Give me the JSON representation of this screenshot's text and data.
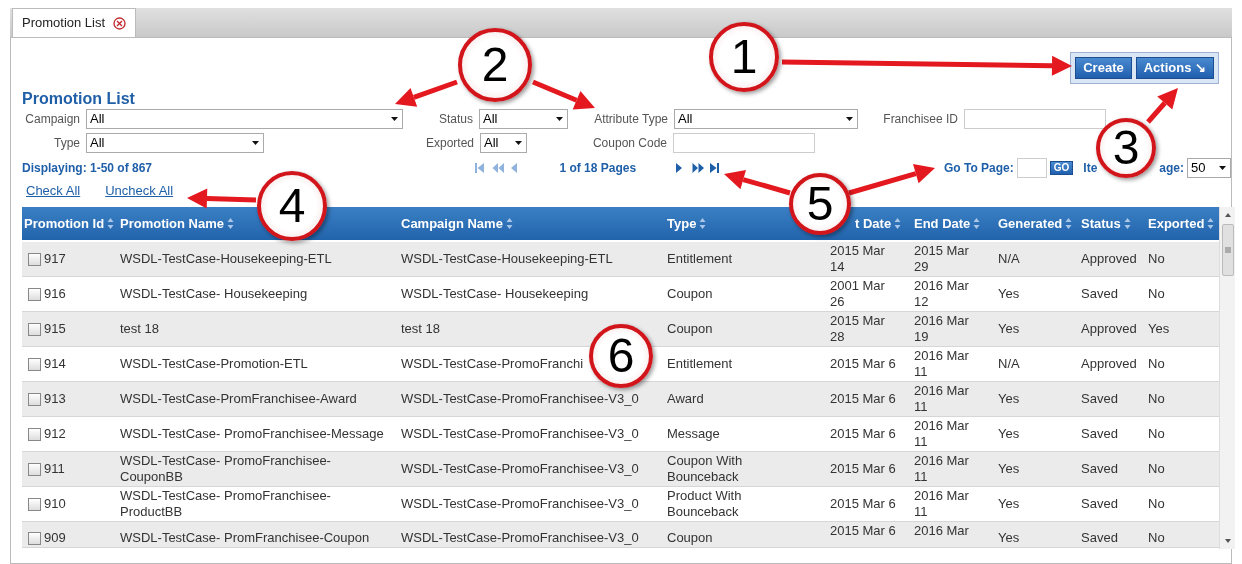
{
  "tab": {
    "label": "Promotion List",
    "selected": true
  },
  "page_title": "Promotion List",
  "buttons": [
    "Create",
    "Actions ↘"
  ],
  "filters": [
    {
      "label": "Campaign",
      "kind": "select",
      "value": "All"
    },
    {
      "label": "Status",
      "kind": "select",
      "value": "All"
    },
    {
      "label": "Attribute Type",
      "kind": "select",
      "value": "All"
    },
    {
      "label": "Franchisee ID",
      "kind": "input"
    },
    {
      "label": "Type",
      "kind": "select",
      "value": "All"
    },
    {
      "label": "Exported",
      "kind": "select",
      "value": "All"
    },
    {
      "label": "Coupon Code",
      "kind": "input"
    }
  ],
  "pager": {
    "displaying": "Displaying: 1-50 of 867",
    "page_info": "1 of 18 Pages",
    "nav": [
      {
        "kind": "first",
        "disabled": true
      },
      {
        "kind": "fast-back",
        "disabled": true
      },
      {
        "kind": "back",
        "disabled": true
      },
      {
        "kind": "next",
        "disabled": false
      },
      {
        "kind": "fast-forward",
        "disabled": false
      },
      {
        "kind": "last",
        "disabled": false
      }
    ],
    "go_label": "Go To Page:",
    "go_button": "GO",
    "items_label_start": "Ite",
    "items_label_end": "age:",
    "items_value": "50"
  },
  "links": [
    "Check All",
    "Uncheck All"
  ],
  "table": {
    "columns": [
      "Promotion Id",
      "Promotion Name",
      "Campaign Name",
      "Type",
      "t Date",
      "End Date",
      "Generated",
      "Status",
      "Exported"
    ],
    "rows": [
      {
        "checked": false,
        "cells": [
          "917",
          "WSDL-TestCase-Housekeeping-ETL",
          "WSDL-TestCase-Housekeeping-ETL",
          "Entitlement",
          "2015 Mar 14",
          "2015 Mar 29",
          "N/A",
          "Approved",
          "No"
        ]
      },
      {
        "checked": false,
        "cells": [
          "916",
          "WSDL-TestCase- Housekeeping",
          "WSDL-TestCase- Housekeeping",
          "Coupon",
          "2001 Mar 26",
          "2016 Mar 12",
          "Yes",
          "Saved",
          "No"
        ]
      },
      {
        "checked": false,
        "cells": [
          "915",
          "test 18",
          "test 18",
          "Coupon",
          "2015 Mar 28",
          "2016 Mar 19",
          "Yes",
          "Approved",
          "Yes"
        ]
      },
      {
        "checked": false,
        "cells": [
          "914",
          "WSDL-TestCase-Promotion-ETL",
          "WSDL-TestCase-PromoFranchi",
          "Entitlement",
          "2015 Mar 6",
          "2016 Mar 11",
          "N/A",
          "Approved",
          "No"
        ]
      },
      {
        "checked": false,
        "cells": [
          "913",
          "WSDL-TestCase-PromFranchisee-Award",
          "WSDL-TestCase-PromoFranchisee-V3_0",
          "Award",
          "2015 Mar 6",
          "2016 Mar 11",
          "Yes",
          "Saved",
          "No"
        ]
      },
      {
        "checked": false,
        "cells": [
          "912",
          "WSDL-TestCase- PromoFranchisee-Message",
          "WSDL-TestCase-PromoFranchisee-V3_0",
          "Message",
          "2015 Mar 6",
          "2016 Mar 11",
          "Yes",
          "Saved",
          "No"
        ]
      },
      {
        "checked": false,
        "cells": [
          "911",
          "WSDL-TestCase- PromoFranchisee-CouponBB",
          "WSDL-TestCase-PromoFranchisee-V3_0",
          "Coupon With Bounceback",
          "2015 Mar 6",
          "2016 Mar 11",
          "Yes",
          "Saved",
          "No"
        ]
      },
      {
        "checked": false,
        "cells": [
          "910",
          "WSDL-TestCase- PromoFranchisee-ProductBB",
          "WSDL-TestCase-PromoFranchisee-V3_0",
          "Product With Bounceback",
          "2015 Mar 6",
          "2016 Mar 11",
          "Yes",
          "Saved",
          "No"
        ]
      },
      {
        "checked": false,
        "cells": [
          "909",
          "WSDL-TestCase- PromFranchisee-Coupon",
          "WSDL-TestCase-PromoFranchisee-V3_0",
          "Coupon",
          "2015 Mar 6",
          "2016 Mar",
          "Yes",
          "Saved",
          "No"
        ]
      }
    ]
  },
  "callouts": [
    {
      "label": "1"
    },
    {
      "label": "2"
    },
    {
      "label": "3"
    },
    {
      "label": "4"
    },
    {
      "label": "5"
    },
    {
      "label": "6"
    }
  ]
}
